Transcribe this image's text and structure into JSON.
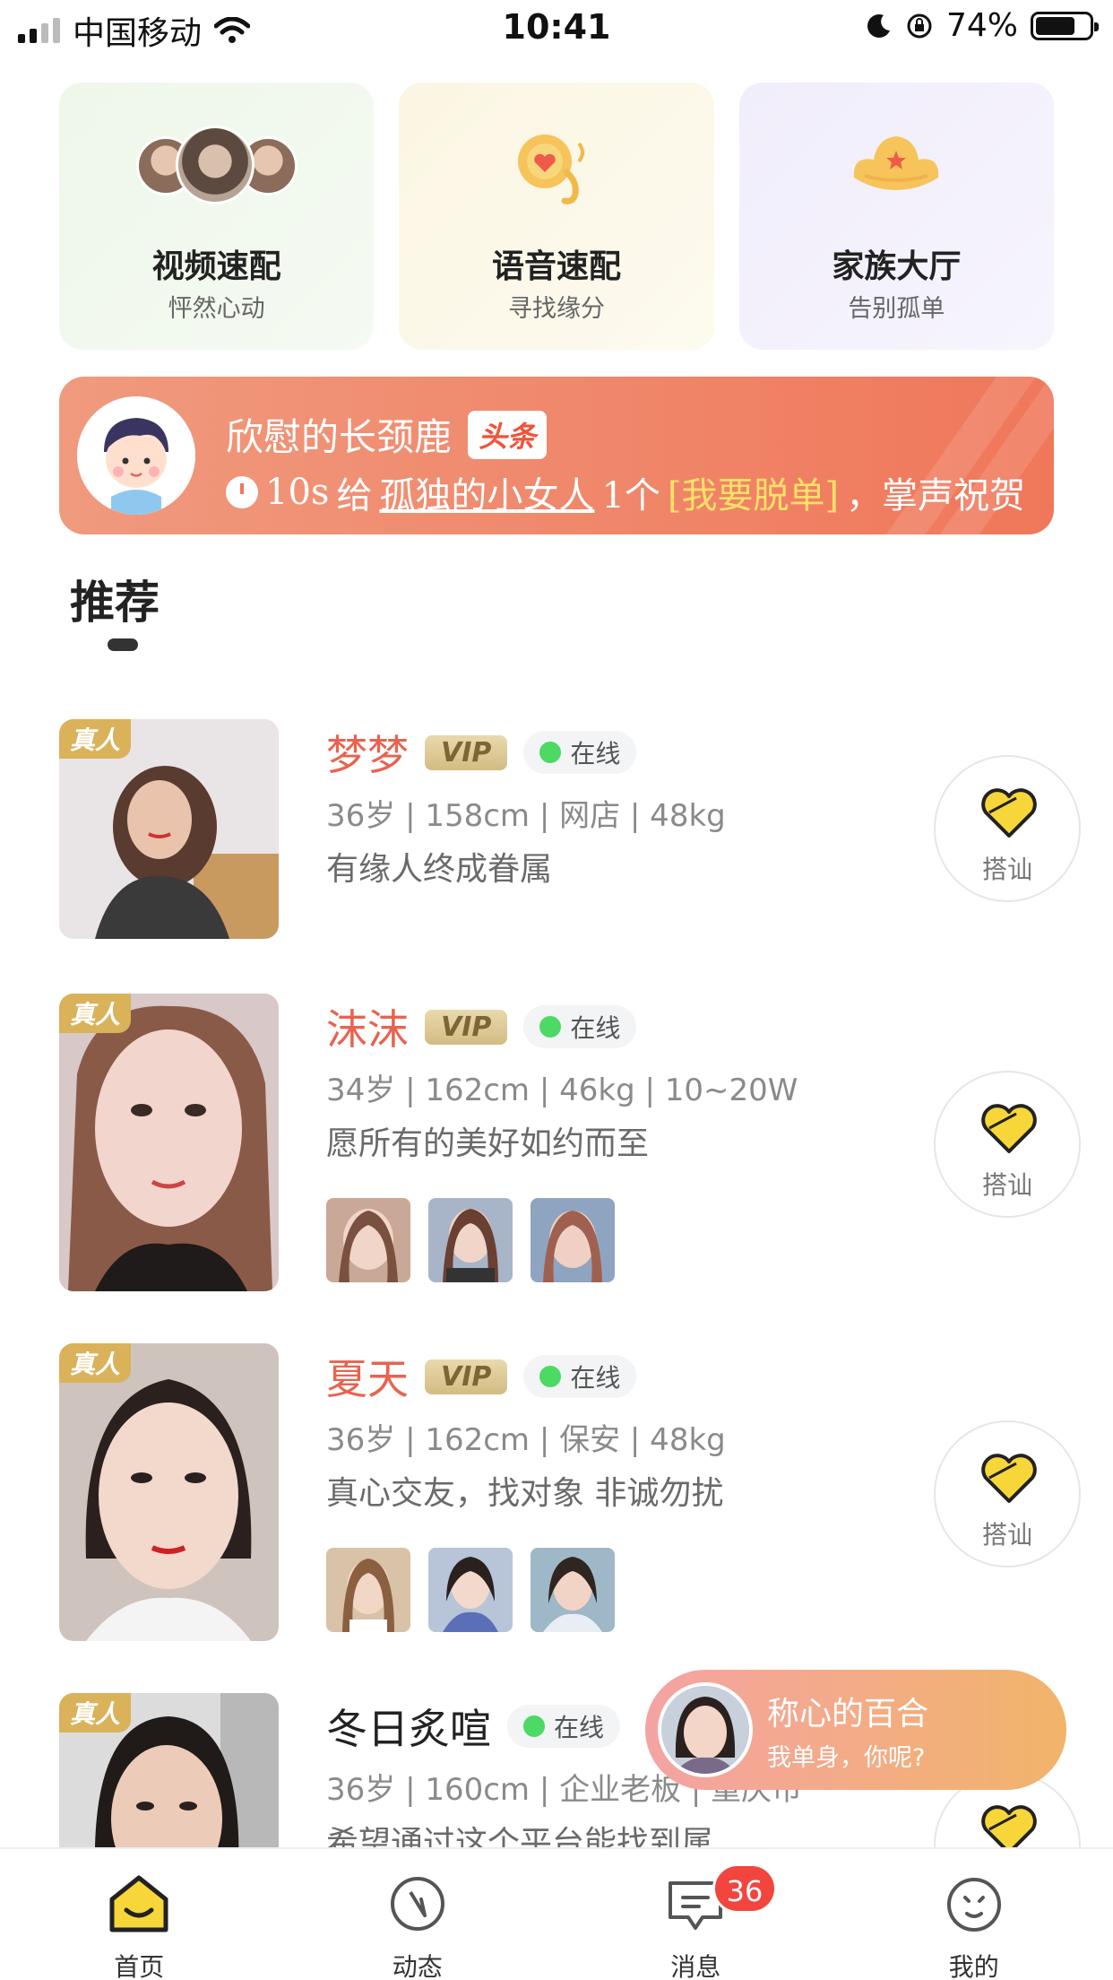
{
  "status_bar": {
    "carrier": "中国移动",
    "time": "10:41",
    "battery": "74%",
    "battery_level": 0.74
  },
  "quick_cards": [
    {
      "title": "视频速配",
      "subtitle": "怦然心动",
      "icon": "video-match-avatars"
    },
    {
      "title": "语音速配",
      "subtitle": "寻找缘分",
      "icon": "voice-match-icon"
    },
    {
      "title": "家族大厅",
      "subtitle": "告别孤单",
      "icon": "family-hall-icon"
    }
  ],
  "banner": {
    "user": "欣慰的长颈鹿",
    "tag": "头条",
    "time": "10s",
    "verb": "给",
    "target": "孤独的小女人",
    "count": "1个",
    "gift": "[我要脱单]",
    "tail": "，掌声祝贺"
  },
  "section": {
    "title": "推荐"
  },
  "profiles": [
    {
      "name": "梦梦",
      "vip": "VIP",
      "status": "在线",
      "real_badge": "真人",
      "info": "36岁 | 158cm | 网店 | 48kg",
      "motto": "有缘人终成眷属",
      "greet": "搭讪"
    },
    {
      "name": "沫沫",
      "vip": "VIP",
      "status": "在线",
      "real_badge": "真人",
      "info": "34岁 | 162cm | 46kg | 10~20W",
      "motto": "愿所有的美好如约而至",
      "greet": "搭讪"
    },
    {
      "name": "夏天",
      "vip": "VIP",
      "status": "在线",
      "real_badge": "真人",
      "info": "36岁 | 162cm | 保安 | 48kg",
      "motto": "真心交友，找对象 非诚勿扰",
      "greet": "搭讪"
    },
    {
      "name": "冬日炙喧",
      "status": "在线",
      "real_badge": "真人",
      "info": "36岁 | 160cm | 企业老板 | 重庆市",
      "motto": "希望通过这个平台能找到属"
    }
  ],
  "float_chat": {
    "name": "称心的百合",
    "message": "我单身，你呢?"
  },
  "tabs": [
    {
      "label": "首页",
      "icon": "home-icon"
    },
    {
      "label": "动态",
      "icon": "compass-icon"
    },
    {
      "label": "消息",
      "icon": "message-icon",
      "badge": "36"
    },
    {
      "label": "我的",
      "icon": "profile-face-icon"
    }
  ],
  "colors": {
    "accent_red": "#e8634f",
    "banner_orange": "#f0775a",
    "heart_yellow": "#f7d63a",
    "online_green": "#4cd964",
    "badge_red": "#f2453d"
  }
}
